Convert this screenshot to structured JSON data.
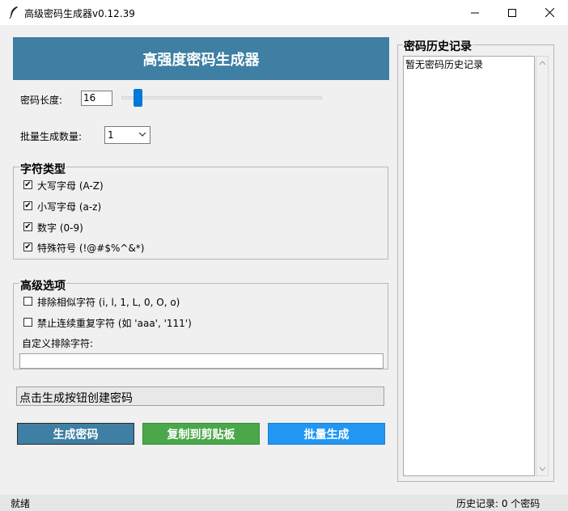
{
  "window": {
    "title": "高级密码生成器v0.12.39"
  },
  "header": {
    "title": "高强度密码生成器"
  },
  "length": {
    "label": "密码长度:",
    "value": "16"
  },
  "batch": {
    "label": "批量生成数量:",
    "selected": "1"
  },
  "char_types": {
    "title": "字符类型",
    "options": [
      {
        "label": "大写字母 (A-Z)",
        "checked": true
      },
      {
        "label": "小写字母 (a-z)",
        "checked": true
      },
      {
        "label": "数字 (0-9)",
        "checked": true
      },
      {
        "label": "特殊符号 (!@#$%^&*)",
        "checked": true
      }
    ]
  },
  "advanced": {
    "title": "高级选项",
    "options": [
      {
        "label": "排除相似字符 (i, l, 1, L, 0, O, o)",
        "checked": false
      },
      {
        "label": "禁止连续重复字符 (如 'aaa', '111')",
        "checked": false
      }
    ],
    "custom_exclude_label": "自定义排除字符:",
    "custom_exclude_value": ""
  },
  "status_message": "点击生成按钮创建密码",
  "buttons": {
    "generate": "生成密码",
    "copy": "复制到剪贴板",
    "batch": "批量生成"
  },
  "history": {
    "title": "密码历史记录",
    "empty_text": "暂无密码历史记录"
  },
  "statusbar": {
    "left": "就绪",
    "right": "历史记录: 0 个密码"
  },
  "colors": {
    "banner": "#3e7fa3",
    "generate": "#3e7fa3",
    "copy": "#4aa74a",
    "batch": "#2196f3",
    "slider": "#0078d7"
  }
}
